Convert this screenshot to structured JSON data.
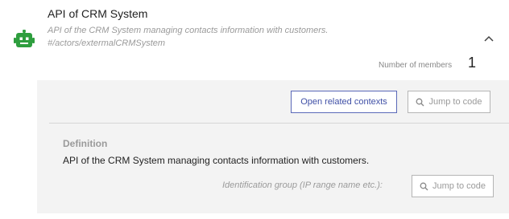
{
  "actor": {
    "title": "API of CRM System",
    "description": "API of the CRM System managing contacts information with customers.",
    "path": "#/actors/extermalCRMSystem",
    "icon": "robot-icon",
    "icon_color": "#2e9e3e"
  },
  "members": {
    "label": "Number of members",
    "count": "1"
  },
  "actions": {
    "open_related_label": "Open related contexts",
    "jump_label": "Jump to code"
  },
  "definition": {
    "heading": "Definition",
    "text": "API of the CRM System managing contacts information with customers.",
    "identification_label": "Identification group (IP range name etc.):",
    "jump_label": "Jump to code"
  },
  "colors": {
    "accent": "#3f4fa6",
    "panel_bg": "#f3f3f3"
  }
}
